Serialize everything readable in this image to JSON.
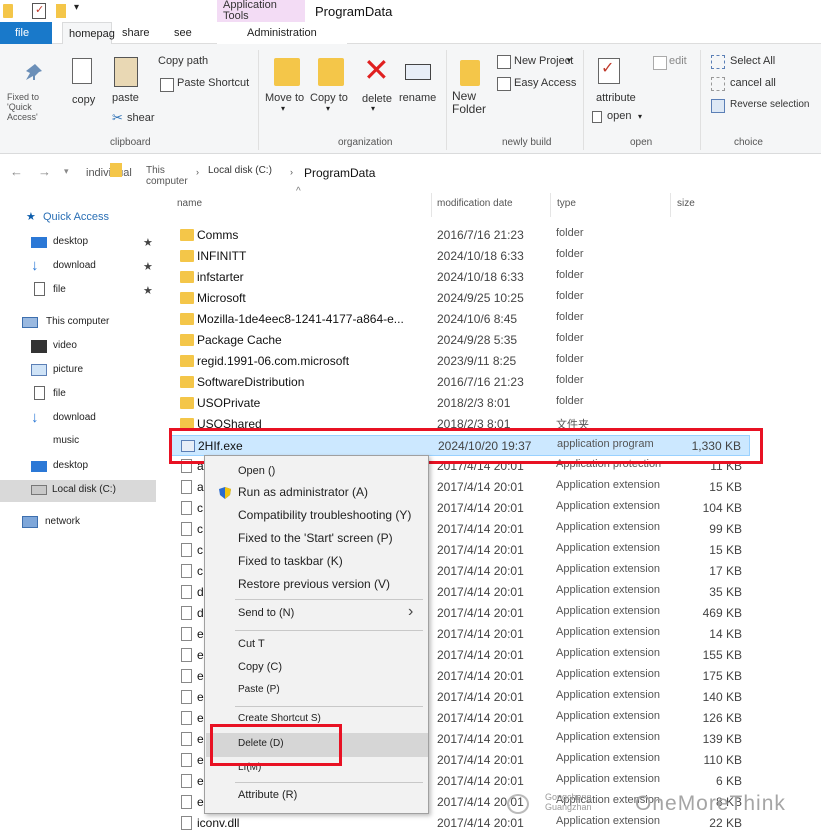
{
  "window": {
    "title": "ProgramData",
    "context_tab_group": "Application Tools"
  },
  "tabs": {
    "file": "file",
    "home": "homepag",
    "share": "share",
    "view": "see",
    "administration": "Administration"
  },
  "ribbon": {
    "clipboard": {
      "group_label": "clipboard",
      "pin": "Fixed to 'Quick Access'",
      "copy": "copy",
      "paste": "paste",
      "copy_path": "Copy path",
      "paste_shortcut": "Paste Shortcut",
      "shear": "shear"
    },
    "organization": {
      "group_label": "organization",
      "move_to": "Move to",
      "copy_to": "Copy to",
      "delete": "delete",
      "rename": "rename"
    },
    "new": {
      "group_label": "newly build",
      "new_folder": "New Folder",
      "new_project": "New Project",
      "easy_access": "Easy Access"
    },
    "open": {
      "group_label": "open",
      "attribute": "attribute",
      "open": "open",
      "edit": "edit"
    },
    "select": {
      "group_label": "choice",
      "select_all": "Select All",
      "cancel_all": "cancel all",
      "reverse_selection": "Reverse selection"
    }
  },
  "breadcrumb": {
    "segments": [
      "individual",
      "This computer",
      "Local disk (C:)",
      "ProgramData"
    ]
  },
  "sidebar": {
    "quick_access": "Quick Access",
    "quick_items": [
      "desktop",
      "download",
      "file"
    ],
    "this_computer": "This computer",
    "computer_items": [
      "video",
      "picture",
      "file",
      "download",
      "music",
      "desktop",
      "Local disk (C:)"
    ],
    "network": "network"
  },
  "columns": {
    "name": "name",
    "date": "modification date",
    "type": "type",
    "size": "size"
  },
  "rows": [
    {
      "name": "Comms",
      "date": "2016/7/16 21:23",
      "type": "folder",
      "size": ""
    },
    {
      "name": "INFINITT",
      "date": "2024/10/18 6:33",
      "type": "folder",
      "size": ""
    },
    {
      "name": "infstarter",
      "date": "2024/10/18 6:33",
      "type": "folder",
      "size": ""
    },
    {
      "name": "Microsoft",
      "date": "2024/9/25 10:25",
      "type": "folder",
      "size": ""
    },
    {
      "name": "Mozilla-1de4eec8-1241-4177-a864-e...",
      "date": "2024/10/6 8:45",
      "type": "folder",
      "size": ""
    },
    {
      "name": "Package Cache",
      "date": "2024/9/28 5:35",
      "type": "folder",
      "size": ""
    },
    {
      "name": "regid.1991-06.com.microsoft",
      "date": "2023/9/11 8:25",
      "type": "folder",
      "size": ""
    },
    {
      "name": "SoftwareDistribution",
      "date": "2016/7/16 21:23",
      "type": "folder",
      "size": ""
    },
    {
      "name": "USOPrivate",
      "date": "2018/2/3 8:01",
      "type": "folder",
      "size": ""
    },
    {
      "name": "USOShared",
      "date": "2018/2/3 8:01",
      "type": "文件夹",
      "size": ""
    },
    {
      "name": "2HIf.exe",
      "date": "2024/10/20 19:37",
      "type": "application program",
      "size": "1,330 KB"
    },
    {
      "name": "a",
      "date": "2017/4/14 20:01",
      "type": "Application protection",
      "size": "11 KB"
    },
    {
      "name": "a",
      "date": "2017/4/14 20:01",
      "type": "Application extension",
      "size": "15 KB"
    },
    {
      "name": "c",
      "date": "2017/4/14 20:01",
      "type": "Application extension",
      "size": "104 KB"
    },
    {
      "name": "c",
      "date": "2017/4/14 20:01",
      "type": "Application extension",
      "size": "99 KB"
    },
    {
      "name": "c",
      "date": "2017/4/14 20:01",
      "type": "Application extension",
      "size": "15 KB"
    },
    {
      "name": "c",
      "date": "2017/4/14 20:01",
      "type": "Application extension",
      "size": "17 KB"
    },
    {
      "name": "d",
      "date": "2017/4/14 20:01",
      "type": "Application extension",
      "size": "35 KB"
    },
    {
      "name": "d",
      "date": "2017/4/14 20:01",
      "type": "Application extension",
      "size": "469 KB"
    },
    {
      "name": "e",
      "date": "2017/4/14 20:01",
      "type": "Application extension",
      "size": "14 KB"
    },
    {
      "name": "e",
      "date": "2017/4/14 20:01",
      "type": "Application extension",
      "size": "155 KB"
    },
    {
      "name": "e",
      "date": "2017/4/14 20:01",
      "type": "Application extension",
      "size": "175 KB"
    },
    {
      "name": "e",
      "date": "2017/4/14 20:01",
      "type": "Application extension",
      "size": "140 KB"
    },
    {
      "name": "e",
      "date": "2017/4/14 20:01",
      "type": "Application extension",
      "size": "126 KB"
    },
    {
      "name": "e",
      "date": "2017/4/14 20:01",
      "type": "Application extension",
      "size": "139 KB"
    },
    {
      "name": "e",
      "date": "2017/4/14 20:01",
      "type": "Application extension",
      "size": "110 KB"
    },
    {
      "name": "e",
      "date": "2017/4/14 20:01",
      "type": "Application extension",
      "size": "6 KB"
    },
    {
      "name": "e",
      "date": "2017/4/14 20:01",
      "type": "Application extension",
      "size": "8 KB"
    },
    {
      "name": "iconv.dll",
      "date": "2017/4/14 20:01",
      "type": "Application extension",
      "size": "22 KB"
    }
  ],
  "context_menu": {
    "open": "Open ()",
    "run_as_admin": "Run as administrator (A)",
    "compat": "Compatibility troubleshooting (Y)",
    "pin_start": "Fixed to the 'Start' screen (P)",
    "pin_taskbar": "Fixed to taskbar (K)",
    "restore": "Restore previous version (V)",
    "send_to": "Send to (N)",
    "cut": "Cut T",
    "copy": "Copy (C)",
    "paste": "Paste (P)",
    "create_shortcut": "Create Shortcut S)",
    "delete": "Delete (D)",
    "rename": "LI(M)",
    "attribute": "Attribute (R)"
  },
  "watermark": {
    "line1": "Gongcheng",
    "line2": "Guangzhan",
    "brand": "OneMoreThink"
  },
  "colors": {
    "accent": "#1979ca",
    "selection": "#cce8ff",
    "highlight_box": "#e81123",
    "folder": "#f4c649"
  }
}
